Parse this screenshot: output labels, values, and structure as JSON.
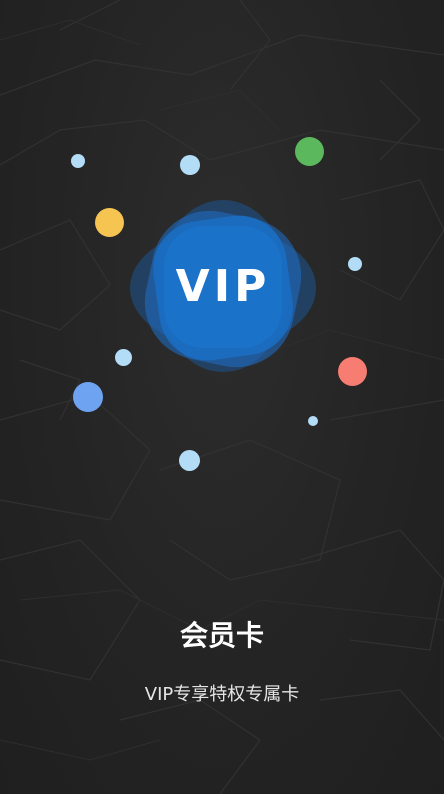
{
  "badge": {
    "label": "VIP",
    "color": "#1a6fc4"
  },
  "title": "会员卡",
  "subtitle": "VIP专享特权专属卡",
  "dots": [
    {
      "name": "light-blue-dot",
      "color": "#b3dcf7"
    },
    {
      "name": "light-blue-dot",
      "color": "#b3dcf7"
    },
    {
      "name": "green-dot",
      "color": "#5cb85c"
    },
    {
      "name": "yellow-dot",
      "color": "#f5c451"
    },
    {
      "name": "light-blue-dot",
      "color": "#b3dcf7"
    },
    {
      "name": "light-blue-dot",
      "color": "#b3dcf7"
    },
    {
      "name": "blue-dot",
      "color": "#6ea3f2"
    },
    {
      "name": "coral-dot",
      "color": "#f77c72"
    },
    {
      "name": "light-blue-dot",
      "color": "#b3dcf7"
    },
    {
      "name": "light-blue-dot",
      "color": "#b3dcf7"
    }
  ]
}
